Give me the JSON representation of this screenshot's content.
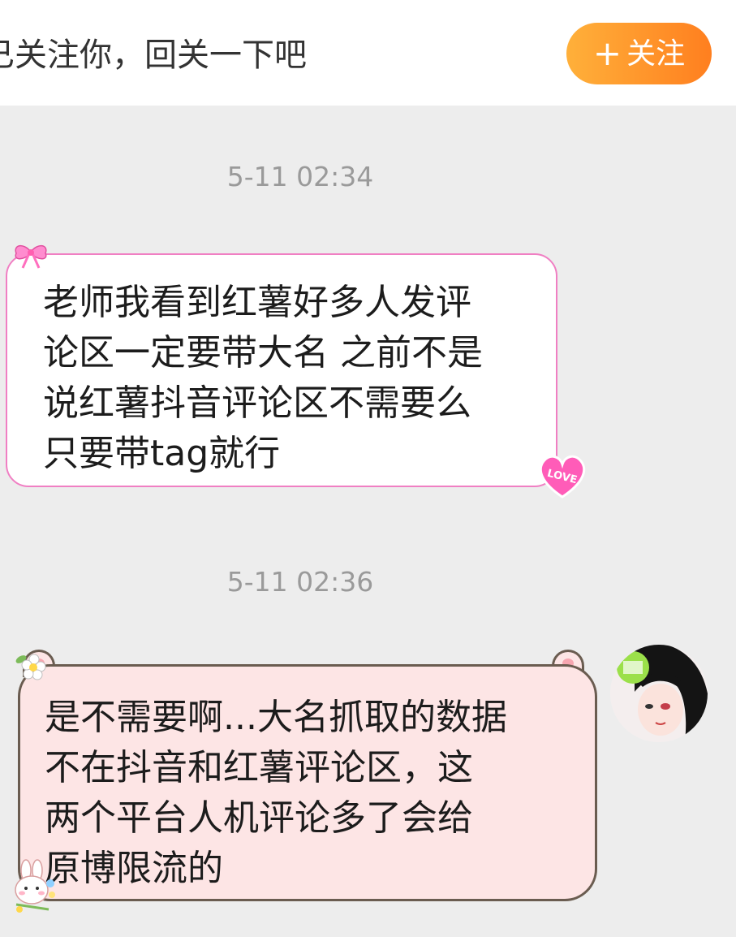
{
  "header": {
    "follow_prompt": "已关注你，回关一下吧",
    "follow_button_plus": "+",
    "follow_button_label": "关注"
  },
  "messages": [
    {
      "timestamp": "5-11 02:34",
      "direction": "incoming",
      "lines": [
        "老师我看到红薯好多人发评",
        "论区一定要带大名 之前不是",
        "说红薯抖音评论区不需要么",
        "只要带tag就行"
      ]
    },
    {
      "timestamp": "5-11 02:36",
      "direction": "outgoing",
      "lines": [
        "是不需要啊...大名抓取的数据",
        "不在抖音和红薯评论区，这",
        "两个平台人机评论多了会给",
        "原博限流的"
      ]
    }
  ],
  "stickers": {
    "heart_text": "LOVE"
  },
  "colors": {
    "follow_button": "#ff8f27",
    "incoming_border": "#f07fc3",
    "outgoing_bg": "#fde5e5",
    "outgoing_border": "#6a5c50",
    "background": "#ededed"
  },
  "icons": [
    "bow-icon",
    "love-heart-icon",
    "flower-icon",
    "bunny-icon",
    "avatar"
  ]
}
